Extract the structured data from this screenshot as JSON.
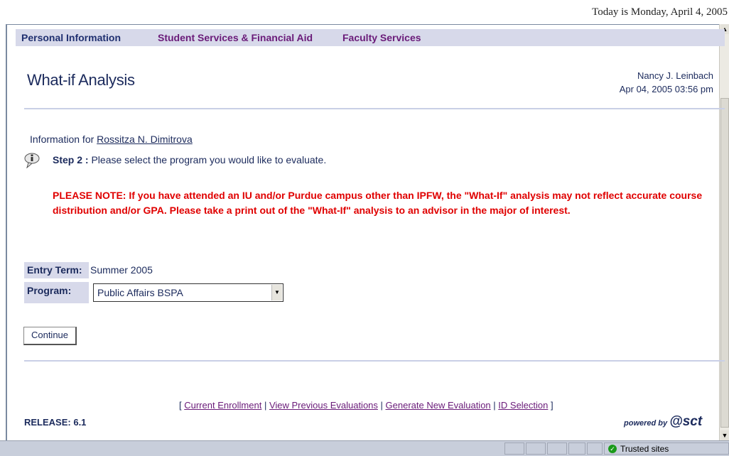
{
  "date_line": "Today is Monday, April 4, 2005",
  "nav": {
    "tabs": [
      {
        "label": "Personal Information"
      },
      {
        "label": "Student Services & Financial Aid"
      },
      {
        "label": "Faculty Services"
      }
    ]
  },
  "header": {
    "title": "What-if Analysis",
    "user_name": "Nancy J. Leinbach",
    "timestamp": "Apr 04, 2005 03:56 pm"
  },
  "info": {
    "prefix": "Information for",
    "student_name": "Rossitza N. Dimitrova"
  },
  "step": {
    "label": "Step 2 :",
    "text": "Please select the program you would like to evaluate."
  },
  "note": "PLEASE NOTE: If you have attended an IU and/or Purdue campus other than IPFW, the \"What-If\" analysis may not reflect accurate course distribution and/or GPA. Please take a print out of the \"What-If\" analysis to an advisor in the major of interest.",
  "form": {
    "entry_term_label": "Entry Term:",
    "entry_term_value": "Summer 2005",
    "program_label": "Program:",
    "program_value": "Public Affairs BSPA",
    "continue_label": "Continue"
  },
  "footer": {
    "links": [
      {
        "label": "Current Enrollment"
      },
      {
        "label": "View Previous Evaluations"
      },
      {
        "label": "Generate New Evaluation"
      },
      {
        "label": "ID Selection"
      }
    ],
    "release": "RELEASE: 6.1",
    "powered_by": "powered by",
    "logo_text": "sct"
  },
  "statusbar": {
    "zone": "Trusted sites"
  }
}
